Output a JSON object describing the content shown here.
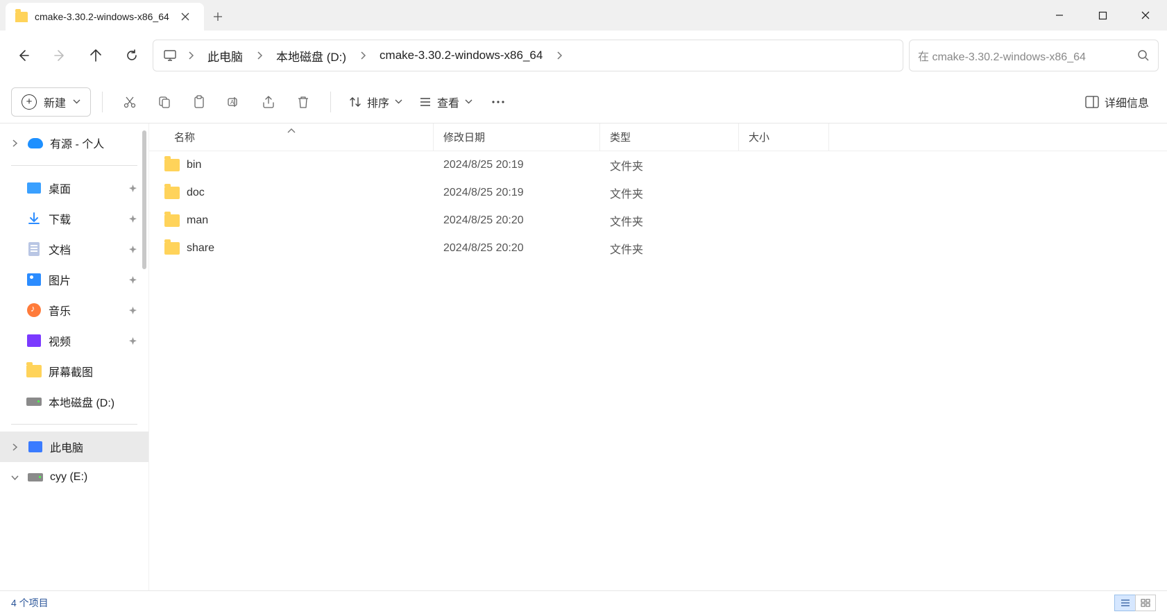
{
  "tab": {
    "title": "cmake-3.30.2-windows-x86_64"
  },
  "breadcrumb": {
    "pc": "此电脑",
    "drive": "本地磁盘 (D:)",
    "folder": "cmake-3.30.2-windows-x86_64"
  },
  "search": {
    "placeholder": "在 cmake-3.30.2-windows-x86_64"
  },
  "toolbar": {
    "new": "新建",
    "sort": "排序",
    "view": "查看",
    "details": "详细信息"
  },
  "sidebar": {
    "onedrive": "有源 - 个人",
    "items": [
      {
        "label": "桌面",
        "icon": "desktop",
        "pinned": true
      },
      {
        "label": "下载",
        "icon": "download",
        "pinned": true
      },
      {
        "label": "文档",
        "icon": "doc",
        "pinned": true
      },
      {
        "label": "图片",
        "icon": "pic",
        "pinned": true
      },
      {
        "label": "音乐",
        "icon": "music",
        "pinned": true
      },
      {
        "label": "视频",
        "icon": "video",
        "pinned": true
      },
      {
        "label": "屏幕截图",
        "icon": "folder",
        "pinned": false
      },
      {
        "label": "本地磁盘 (D:)",
        "icon": "drive",
        "pinned": false
      }
    ],
    "pc": "此电脑",
    "cyy": "cyy (E:)"
  },
  "columns": {
    "name": "名称",
    "date": "修改日期",
    "type": "类型",
    "size": "大小"
  },
  "rows": [
    {
      "name": "bin",
      "date": "2024/8/25 20:19",
      "type": "文件夹",
      "size": ""
    },
    {
      "name": "doc",
      "date": "2024/8/25 20:19",
      "type": "文件夹",
      "size": ""
    },
    {
      "name": "man",
      "date": "2024/8/25 20:20",
      "type": "文件夹",
      "size": ""
    },
    {
      "name": "share",
      "date": "2024/8/25 20:20",
      "type": "文件夹",
      "size": ""
    }
  ],
  "status": {
    "count": "4 个项目"
  }
}
